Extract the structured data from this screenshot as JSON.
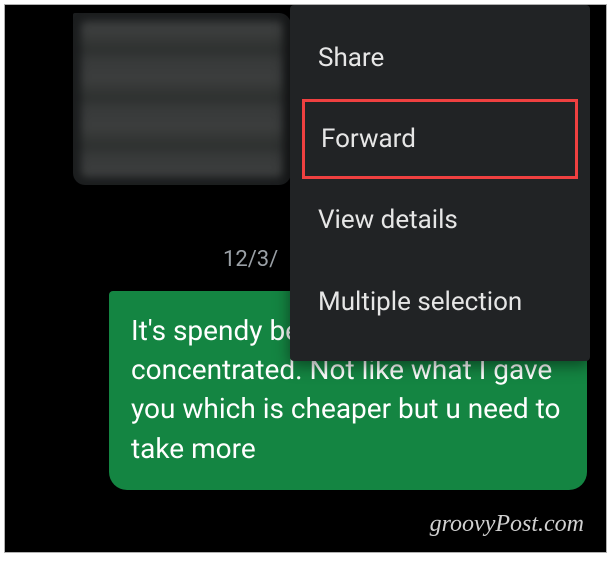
{
  "date_label": "12/3/",
  "message": {
    "text": "It's spendy because it's concentrated. Not like what I gave you which is cheaper but u need to take more",
    "bubble_color": "#148542"
  },
  "context_menu": {
    "items": [
      {
        "label": "Share",
        "highlighted": false
      },
      {
        "label": "Forward",
        "highlighted": true
      },
      {
        "label": "View details",
        "highlighted": false
      },
      {
        "label": "Multiple selection",
        "highlighted": false
      }
    ]
  },
  "watermark": "groovyPost.com"
}
